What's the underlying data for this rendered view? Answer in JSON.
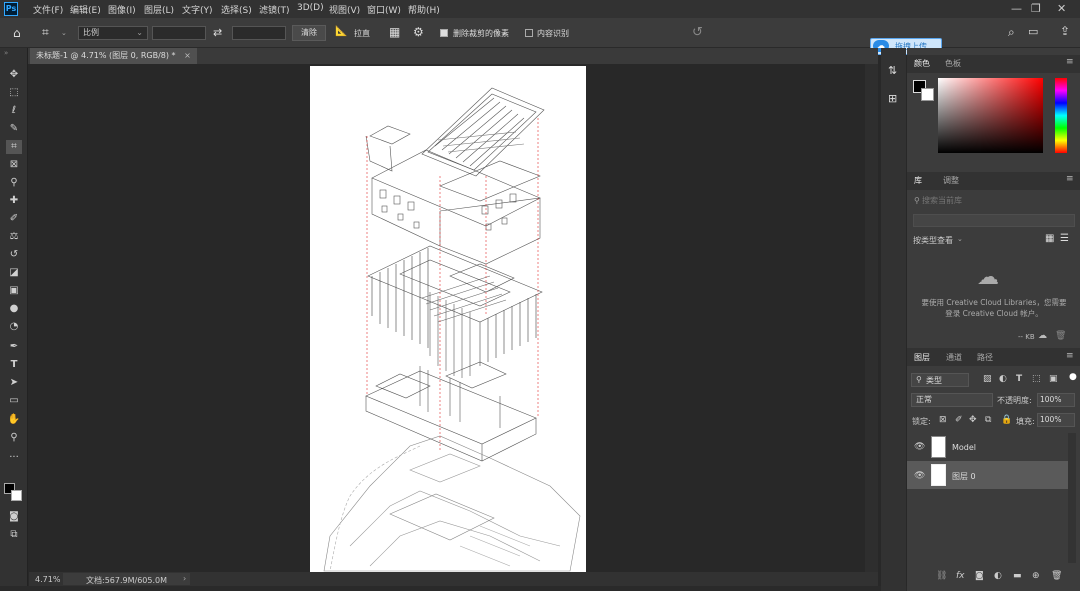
{
  "app": {
    "logo": "Ps"
  },
  "menu": [
    "文件(F)",
    "编辑(E)",
    "图像(I)",
    "图层(L)",
    "文字(Y)",
    "选择(S)",
    "滤镜(T)",
    "3D(D)",
    "视图(V)",
    "窗口(W)",
    "帮助(H)"
  ],
  "window_controls": {
    "minimize": "—",
    "restore": "❐",
    "close": "✕"
  },
  "options_bar": {
    "ratio_select": "比例",
    "swap_icon": "⇄",
    "clear_button": "清除",
    "straighten_label": "拉直",
    "delete_cropped_label": "删除裁剪的像素",
    "delete_cropped_checked": true,
    "content_aware_label": "内容识别",
    "content_aware_checked": false
  },
  "document_tab": {
    "title": "未标题-1 @ 4.71% (图层 0, RGB/8) *",
    "close": "×"
  },
  "upload_button": "拖拽上传",
  "status": {
    "zoom": "4.71%",
    "doc_info": "文档:567.9M/605.0M",
    "arrow": "›"
  },
  "color_panel": {
    "tabs": [
      "颜色",
      "色板"
    ]
  },
  "library_panel": {
    "tabs": [
      "库",
      "调整"
    ],
    "search_placeholder": "搜索当前库",
    "view_by": "按类型查看",
    "message": "要使用 Creative Cloud Libraries，您需要登录 Creative Cloud 帐户。",
    "size": "-- KB"
  },
  "layers_panel": {
    "tabs": [
      "图层",
      "通道",
      "路径"
    ],
    "filter": "类型",
    "blend_mode": "正常",
    "opacity_label": "不透明度:",
    "opacity_value": "100%",
    "lock_label": "锁定:",
    "fill_label": "填充:",
    "fill_value": "100%",
    "layers": [
      {
        "name": "Model",
        "visible": true,
        "selected": false
      },
      {
        "name": "图层 0",
        "visible": true,
        "selected": true
      }
    ],
    "footer_icons": [
      "link-icon",
      "fx-icon",
      "mask-icon",
      "adjustment-icon",
      "folder-icon",
      "new-layer-icon",
      "trash-icon"
    ]
  },
  "colors": {
    "accent": "#31a8ff",
    "bg": "#282828",
    "panel": "#3c3c3c",
    "guide": "#e03030"
  }
}
